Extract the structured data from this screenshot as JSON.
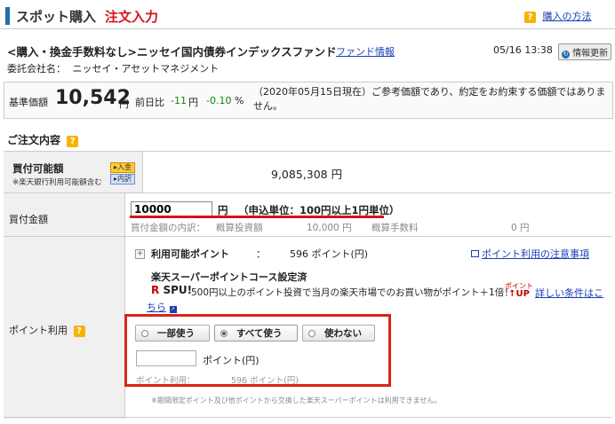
{
  "header": {
    "title": "スポット購入",
    "subtitle": "注文入力",
    "howto_link": "購入の方法"
  },
  "fund": {
    "title": "<購入・換金手数料なし>ニッセイ国内債券インデックスファンド",
    "info_link": "ファンド情報",
    "datetime": "05/16 13:38",
    "refresh_button": "情報更新",
    "company_label": "委託会社名：",
    "company_name": "ニッセイ・アセットマネジメント"
  },
  "price": {
    "label": "基準価額",
    "value": "10,542",
    "unit": "円",
    "diff_label": "前日比",
    "diff_value": "-11",
    "diff_unit": "円",
    "diff_pct": "-0.10",
    "pct_unit": "%",
    "note": "（2020年05月15日現在）ご参考価額であり、約定をお約束する価額ではありません。"
  },
  "order": {
    "section_title": "ご注文内容",
    "available_label": "買付可能額",
    "available_sublabel": "※楽天銀行利用可能額含む",
    "deposit_button": "入金",
    "detail_button": "内訳",
    "available_amount": "9,085,308 円",
    "amount_label": "買付金額",
    "amount_value": "10000",
    "amount_unit": "円",
    "amount_hint": "（申込単位：100円以上1円単位）",
    "breakdown_label": "買付金額の内訳：",
    "estimated_investment_label": "概算投資額",
    "estimated_investment_value": "10,000 円",
    "estimated_fee_label": "概算手数料",
    "estimated_fee_value": "0 円"
  },
  "points": {
    "row_label": "ポイント利用",
    "expand_icon": "+",
    "available_label": "利用可能ポイント",
    "colon": "：",
    "available_value": "596 ポイント(円)",
    "caution_link": "ポイント利用の注意事項",
    "course": "楽天スーパーポイントコース設定済",
    "spu_r": "R",
    "spu_text": "SPU!",
    "spu_desc": "500円以上のポイント投資で当月の楽天市場でのお買い物がポイント＋1倍！",
    "up_top": "ポイント",
    "up_bottom": "↑UP",
    "details_link_1": "詳しい条件はこ",
    "details_link_2": "ちら",
    "options": [
      "一部使う",
      "すべて使う",
      "使わない"
    ],
    "selected_option": "すべて使う",
    "input_value": "",
    "input_unit": "ポイント(円)",
    "use_label": "ポイント利用：",
    "use_value": "596 ポイント(円)",
    "footnote": "※期間限定ポイント及び他ポイントから交換した楽天スーパーポイントは利用できません。"
  },
  "colors": {
    "accent_red": "#d4141c",
    "link_blue": "#1a3fb4",
    "header_bar": "#1f6fb2",
    "positive_green": "#0a8a00"
  }
}
